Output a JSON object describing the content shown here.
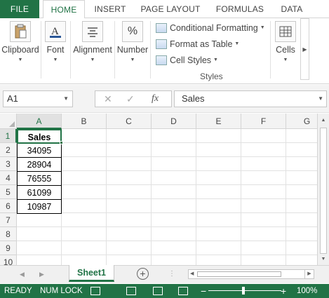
{
  "tabs": {
    "file": "FILE",
    "home": "HOME",
    "insert": "INSERT",
    "page_layout": "PAGE LAYOUT",
    "formulas": "FORMULAS",
    "data": "DATA"
  },
  "ribbon": {
    "clipboard": "Clipboard",
    "font": "Font",
    "alignment": "Alignment",
    "number": "Number",
    "conditional_formatting": "Conditional Formatting",
    "format_as_table": "Format as Table",
    "cell_styles": "Cell Styles",
    "styles_group": "Styles",
    "cells": "Cells"
  },
  "formula_bar": {
    "name_box": "A1",
    "formula_value": "Sales",
    "fx_label": "fx"
  },
  "grid": {
    "columns": [
      "A",
      "B",
      "C",
      "D",
      "E",
      "F",
      "G"
    ],
    "rows": [
      "1",
      "2",
      "3",
      "4",
      "5",
      "6",
      "7",
      "8",
      "9",
      "10"
    ],
    "cells": [
      "Sales",
      "34095",
      "28904",
      "76555",
      "61099",
      "10987"
    ]
  },
  "sheets": {
    "active": "Sheet1"
  },
  "status": {
    "ready": "READY",
    "num_lock": "NUM LOCK",
    "zoom": "100%"
  },
  "colors": {
    "accent": "#217346"
  }
}
